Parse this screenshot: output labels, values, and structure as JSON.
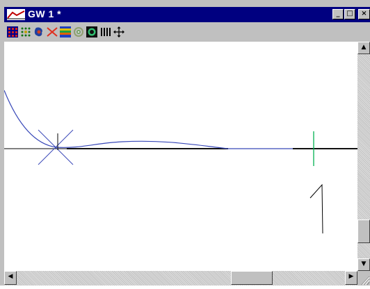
{
  "window": {
    "title": "GW 1 *",
    "title_bar_color": "#000080",
    "controls": {
      "minimize_glyph": "_",
      "maximize_glyph": "□",
      "close_glyph": "×"
    }
  },
  "toolbar": {
    "tools": [
      {
        "name": "grid-icon"
      },
      {
        "name": "dots-pattern-icon"
      },
      {
        "name": "blob-icon"
      },
      {
        "name": "antenna-icon"
      },
      {
        "name": "stripes-icon"
      },
      {
        "name": "target-icon"
      },
      {
        "name": "circle-in-square-icon"
      },
      {
        "name": "bars-icon"
      },
      {
        "name": "move-arrows-icon"
      }
    ]
  },
  "canvas": {
    "curve_color": "#3848b8",
    "axis_color": "#000000",
    "marker_color": "#00b050",
    "annotation": "1"
  },
  "scrollbars": {
    "up_glyph": "▲",
    "down_glyph": "▼",
    "left_glyph": "◀",
    "right_glyph": "▶"
  }
}
